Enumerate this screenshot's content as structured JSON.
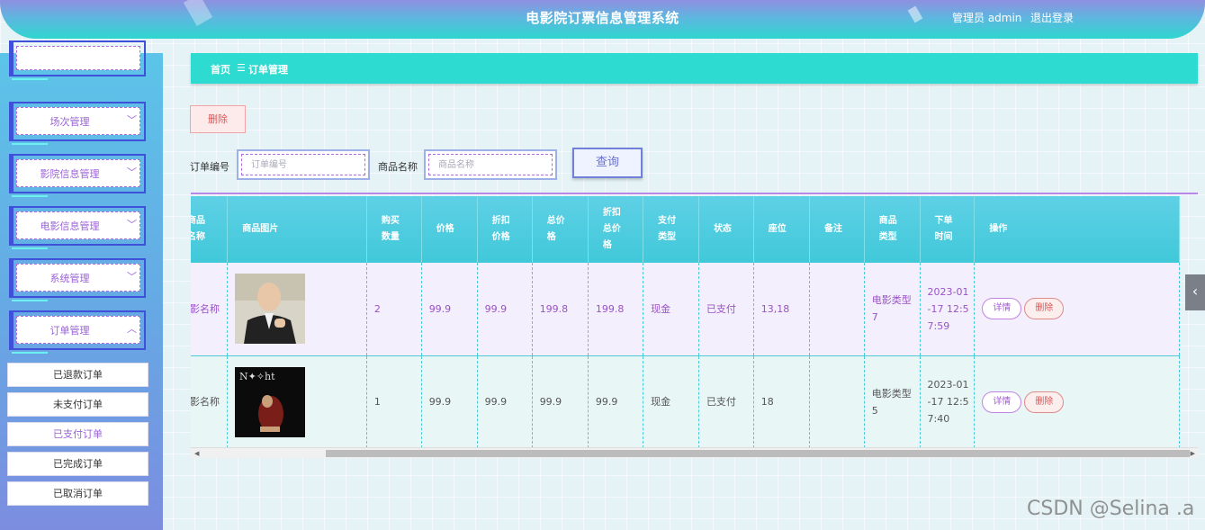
{
  "header": {
    "title": "电影院订票信息管理系统",
    "user": "管理员 admin",
    "logout": "退出登录"
  },
  "sidebar": {
    "menus": [
      {
        "label": "场次管理",
        "chevron": "﹀"
      },
      {
        "label": "影院信息管理",
        "chevron": "﹀"
      },
      {
        "label": "电影信息管理",
        "chevron": "﹀"
      },
      {
        "label": "系统管理",
        "chevron": "﹀"
      },
      {
        "label": "订单管理",
        "chevron": "︿"
      }
    ],
    "submenu": [
      "已退款订单",
      "未支付订单",
      "已支付订单",
      "已完成订单",
      "已取消订单"
    ],
    "active_submenu": "已支付订单"
  },
  "breadcrumb": {
    "home": "首页",
    "sep": "☰",
    "current": "订单管理"
  },
  "toolbar": {
    "delete_label": "删除"
  },
  "search": {
    "order_no_label": "订单编号",
    "order_no_placeholder": "订单编号",
    "product_label": "商品名称",
    "product_placeholder": "商品名称",
    "query_label": "查询"
  },
  "table": {
    "headers": [
      "商品\n名称",
      "商品图片",
      "购买\n数量",
      "价格",
      "折扣\n价格",
      "总价\n格",
      "折扣\n总价\n格",
      "支付\n类型",
      "状态",
      "座位",
      "备注",
      "商品\n类型",
      "下单\n时间",
      "操作"
    ],
    "rows": [
      {
        "name": "电影名称",
        "qty": "2",
        "price": "99.9",
        "disc_price": "99.9",
        "total": "199.8",
        "disc_total": "199.8",
        "pay_type": "现金",
        "status": "已支付",
        "seat": "13,18",
        "note": "",
        "type": "电影类型7",
        "time": "2023-01-17 12:57:59",
        "detail": "详情",
        "delete": "删除",
        "image": "portrait-photo"
      },
      {
        "name": "电影名称",
        "qty": "1",
        "price": "99.9",
        "disc_price": "99.9",
        "total": "99.9",
        "disc_total": "99.9",
        "pay_type": "现金",
        "status": "已支付",
        "seat": "18",
        "note": "",
        "type": "电影类型5",
        "time": "2023-01-17 12:57:40",
        "detail": "详情",
        "delete": "删除",
        "image": "movie-poster"
      }
    ]
  },
  "watermark": "CSDN @Selina .a",
  "colors": {
    "header": "#2fd6cf",
    "accent_purple": "#9a62d8",
    "menu_border": "#3f51d8",
    "danger": "#e05757"
  }
}
